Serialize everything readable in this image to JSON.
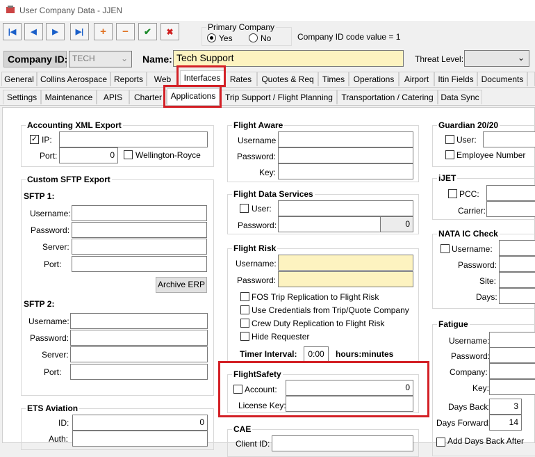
{
  "window": {
    "title": "User Company Data - JJEN"
  },
  "toolbar": {
    "buttons": [
      "first",
      "prev",
      "next",
      "last",
      "add",
      "delete",
      "save",
      "cancel"
    ]
  },
  "primary_company": {
    "label": "Primary Company",
    "yes": "Yes",
    "no": "No",
    "selected": "Yes"
  },
  "company_id_code": "Company ID code value = 1",
  "header": {
    "company_id_label": "Company ID:",
    "company_id_value": "TECH",
    "name_label": "Name:",
    "name_value": "Tech Support",
    "threat_label": "Threat Level:"
  },
  "tabs_main": [
    "General",
    "Collins Aerospace",
    "Reports",
    "Web",
    "Interfaces",
    "Rates",
    "Quotes & Req",
    "Times",
    "Operations",
    "Airport",
    "Itin Fields",
    "Documents"
  ],
  "tabs_sub": [
    "Settings",
    "Maintenance",
    "APIS",
    "Charter",
    "Applications",
    "Trip Support / Flight Planning",
    "Transportation / Catering",
    "Data Sync"
  ],
  "accounting": {
    "title": "Accounting XML Export",
    "ip": "IP:",
    "port": "Port:",
    "port_value": "0",
    "wellington": "Wellington-Royce"
  },
  "sftp": {
    "title": "Custom SFTP Export",
    "sftp1": "SFTP 1:",
    "sftp2": "SFTP 2:",
    "username": "Username:",
    "password": "Password:",
    "server": "Server:",
    "port": "Port:",
    "archive": "Archive ERP"
  },
  "ets": {
    "title": "ETS Aviation",
    "id": "ID:",
    "id_value": "0",
    "auth": "Auth:"
  },
  "flight_aware": {
    "title": "Flight Aware",
    "username": "Username",
    "password": "Password:",
    "key": "Key:"
  },
  "fds": {
    "title": "Flight Data Services",
    "user": "User:",
    "password": "Password:",
    "password_value": "0"
  },
  "flight_risk": {
    "title": "Flight Risk",
    "username": "Username:",
    "password": "Password:",
    "checks": [
      "FOS Trip Replication to Flight Risk",
      "Use Credentials from Trip/Quote Company",
      "Crew Duty Replication to Flight Risk",
      "Hide Requester"
    ],
    "timer_label": "Timer Interval:",
    "timer_value": "0:00",
    "timer_unit": "hours:minutes"
  },
  "flightsafety": {
    "title": "FlightSafety",
    "account": "Account:",
    "account_value": "0",
    "license": "License Key:"
  },
  "cae": {
    "title": "CAE",
    "client": "Client ID:"
  },
  "guardian": {
    "title": "Guardian 20/20",
    "user": "User:",
    "employee": "Employee Number"
  },
  "ijet": {
    "title": "iJET",
    "pcc": "PCC:",
    "carrier": "Carrier:"
  },
  "nata": {
    "title": "NATA IC Check",
    "username": "Username:",
    "password": "Password:",
    "site": "Site:",
    "days": "Days:"
  },
  "fatigue": {
    "title": "Fatigue",
    "username": "Username:",
    "password": "Password:",
    "company": "Company:",
    "key": "Key:",
    "days_back": "Days Back:",
    "days_back_value": "3",
    "days_forward": "Days Forward:",
    "days_forward_value": "14",
    "add_days": "Add Days Back After"
  }
}
